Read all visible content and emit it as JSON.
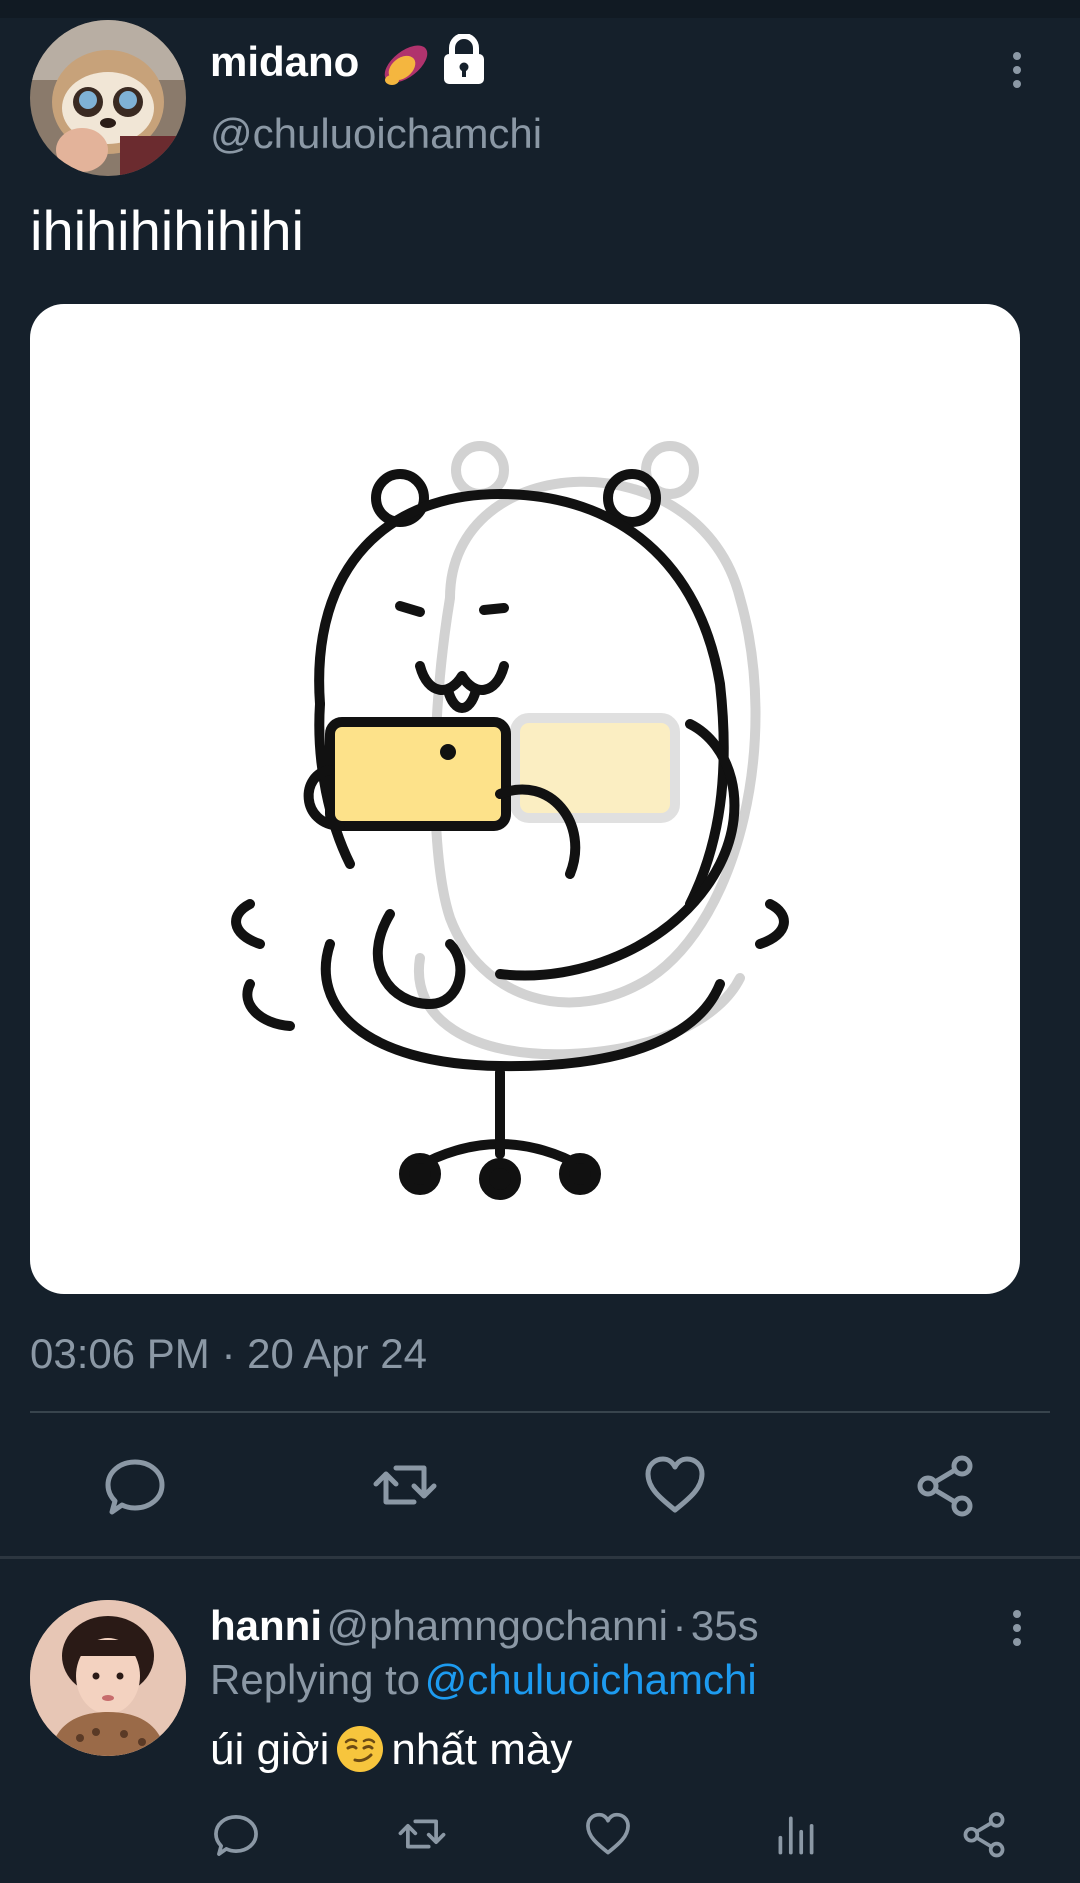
{
  "tweet": {
    "author_name": "midano",
    "author_handle": "@chuluoichamchi",
    "text": "ihihihihihihi",
    "time": "03:06 PM",
    "separator": "·",
    "date": "20 Apr 24"
  },
  "reply": {
    "author_name": "hanni",
    "author_handle": "@phamngochanni",
    "separator": "·",
    "age": "35s",
    "replying_to_label": "Replying to",
    "replying_to_handle": "@chuluoichamchi",
    "text_before_emoji": "úi giời",
    "emoji": "smirking-face",
    "text_after_emoji": "nhất mày"
  },
  "icons": {
    "badge_1": "sweet-potato-icon",
    "badge_2": "lock-icon",
    "more": "more-vertical-icon",
    "actions": [
      "reply-icon",
      "retweet-icon",
      "like-icon",
      "share-icon"
    ],
    "reply_actions": [
      "reply-icon",
      "retweet-icon",
      "like-icon",
      "analytics-icon",
      "share-icon"
    ]
  },
  "colors": {
    "background": "#15202b",
    "text_primary": "#ffffff",
    "text_secondary": "#8b98a5",
    "link": "#1d9bf0",
    "divider": "#38444d"
  }
}
